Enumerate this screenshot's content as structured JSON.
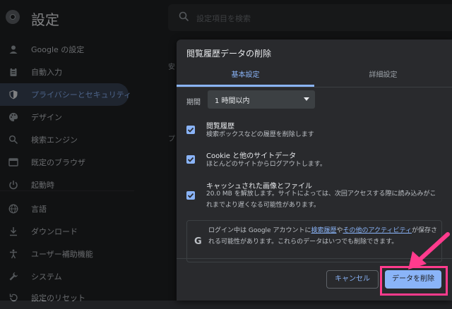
{
  "header": {
    "title": "設定",
    "search_placeholder": "設定項目を検索"
  },
  "sidebar": {
    "items": [
      {
        "label": "Google の設定",
        "icon": "person-icon"
      },
      {
        "label": "自動入力",
        "icon": "clipboard-icon"
      },
      {
        "label": "プライバシーとセキュリティ",
        "icon": "shield-icon",
        "active": true
      },
      {
        "label": "デザイン",
        "icon": "palette-icon"
      },
      {
        "label": "検索エンジン",
        "icon": "search-icon"
      },
      {
        "label": "既定のブラウザ",
        "icon": "browser-icon"
      },
      {
        "label": "起動時",
        "icon": "power-icon"
      },
      {
        "label": "言語",
        "icon": "globe-icon"
      },
      {
        "label": "ダウンロード",
        "icon": "download-icon"
      },
      {
        "label": "ユーザー補助機能",
        "icon": "accessibility-icon"
      },
      {
        "label": "システム",
        "icon": "wrench-icon"
      },
      {
        "label": "設定のリセット",
        "icon": "reset-icon"
      }
    ]
  },
  "background": {
    "fragment_1": "安",
    "fragment_2": "プ"
  },
  "dialog": {
    "title": "閲覧履歴データの削除",
    "tabs": {
      "basic": "基本設定",
      "advanced": "詳細設定"
    },
    "period": {
      "label": "期間",
      "value": "1 時間以内"
    },
    "options": [
      {
        "title": "閲覧履歴",
        "description": "検索ボックスなどの履歴を削除します",
        "checked": true
      },
      {
        "title": "Cookie と他のサイトデータ",
        "description": "ほとんどのサイトからログアウトします。",
        "checked": true
      },
      {
        "title": "キャッシュされた画像とファイル",
        "description": "20.0 MB を解放します。サイトによっては、次回アクセスする際に読み込みがこれまでより遅くなる可能性があります。",
        "checked": true
      }
    ],
    "notice": {
      "g_letter": "G",
      "text_1": "ログイン中は Google アカウントに",
      "link_1": "検索履歴",
      "text_2": "や",
      "link_2": "その他のアクティビティ",
      "text_3": "が保存される可能性があります。これらのデータはいつでも削除できます。"
    },
    "buttons": {
      "cancel": "キャンセル",
      "delete": "データを削除"
    }
  },
  "colors": {
    "accent": "#8ab4f8",
    "highlight": "#ff3b8d",
    "background": "#202124",
    "dialog": "#292a2d"
  }
}
